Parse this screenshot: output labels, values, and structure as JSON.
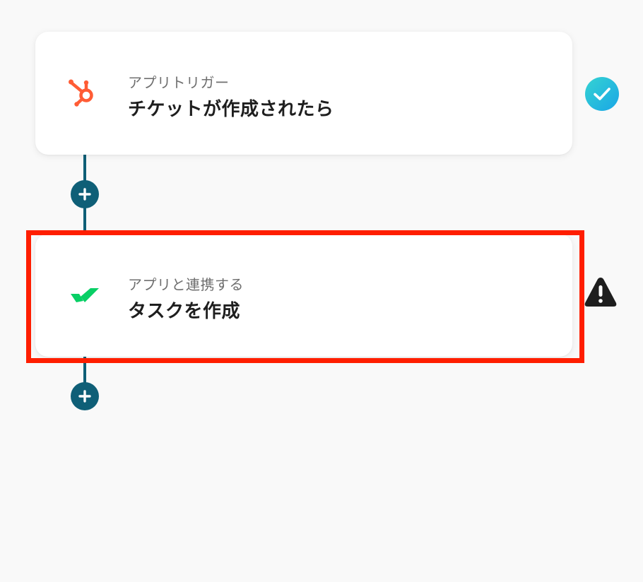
{
  "flow": {
    "steps": [
      {
        "kind_label": "アプリトリガー",
        "title": "チケットが作成されたら",
        "app_icon": "hubspot-icon",
        "status": "completed",
        "status_icon": "check-circle-icon"
      },
      {
        "kind_label": "アプリと連携する",
        "title": "タスクを作成",
        "app_icon": "wrike-icon",
        "status": "warning",
        "status_icon": "warning-triangle-icon",
        "highlighted": true
      }
    ],
    "add_step_icon": "plus-icon"
  },
  "colors": {
    "background": "#f9f9f9",
    "connector": "#0f5f77",
    "highlight": "#ff1e00",
    "check_gradient_start": "#35d3d2",
    "check_gradient_end": "#1aa6e6",
    "hubspot_orange": "#ff5c35",
    "wrike_green": "#08cf65",
    "warning": "#1e1e1e"
  }
}
